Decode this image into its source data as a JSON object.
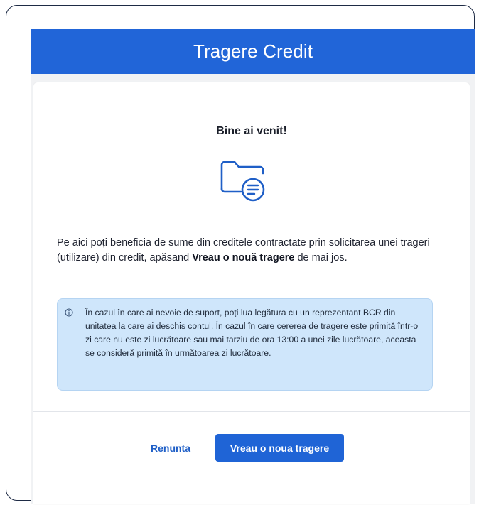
{
  "header": {
    "title": "Tragere Credit"
  },
  "card": {
    "welcome": "Bine ai venit!",
    "folder_icon": "folder-document-icon",
    "intro_before": "Pe aici poți beneficia de sume din creditele contractate prin solicitarea unei trageri (utilizare) din credit, apăsand ",
    "intro_bold": "Vreau o nouă tragere",
    "intro_after": " de mai jos.",
    "info_icon": "info-circle-icon",
    "info_text": "În cazul în care ai nevoie de suport, poți lua legătura cu un reprezentant BCR din unitatea la care ai deschis contul. În cazul în care cererea de tragere este primită într-o zi care nu este zi lucrătoare sau mai tarziu de ora 13:00 a unei zile lucrătoare, aceasta se consideră primită în următoarea zi lucrătoare."
  },
  "actions": {
    "cancel_label": "Renunta",
    "primary_label": "Vreau o noua tragere"
  },
  "colors": {
    "header_bg": "#2165d8",
    "primary_button": "#1f64d6",
    "info_box_bg": "#cfe6fb",
    "frame_border": "#1e2b45"
  }
}
